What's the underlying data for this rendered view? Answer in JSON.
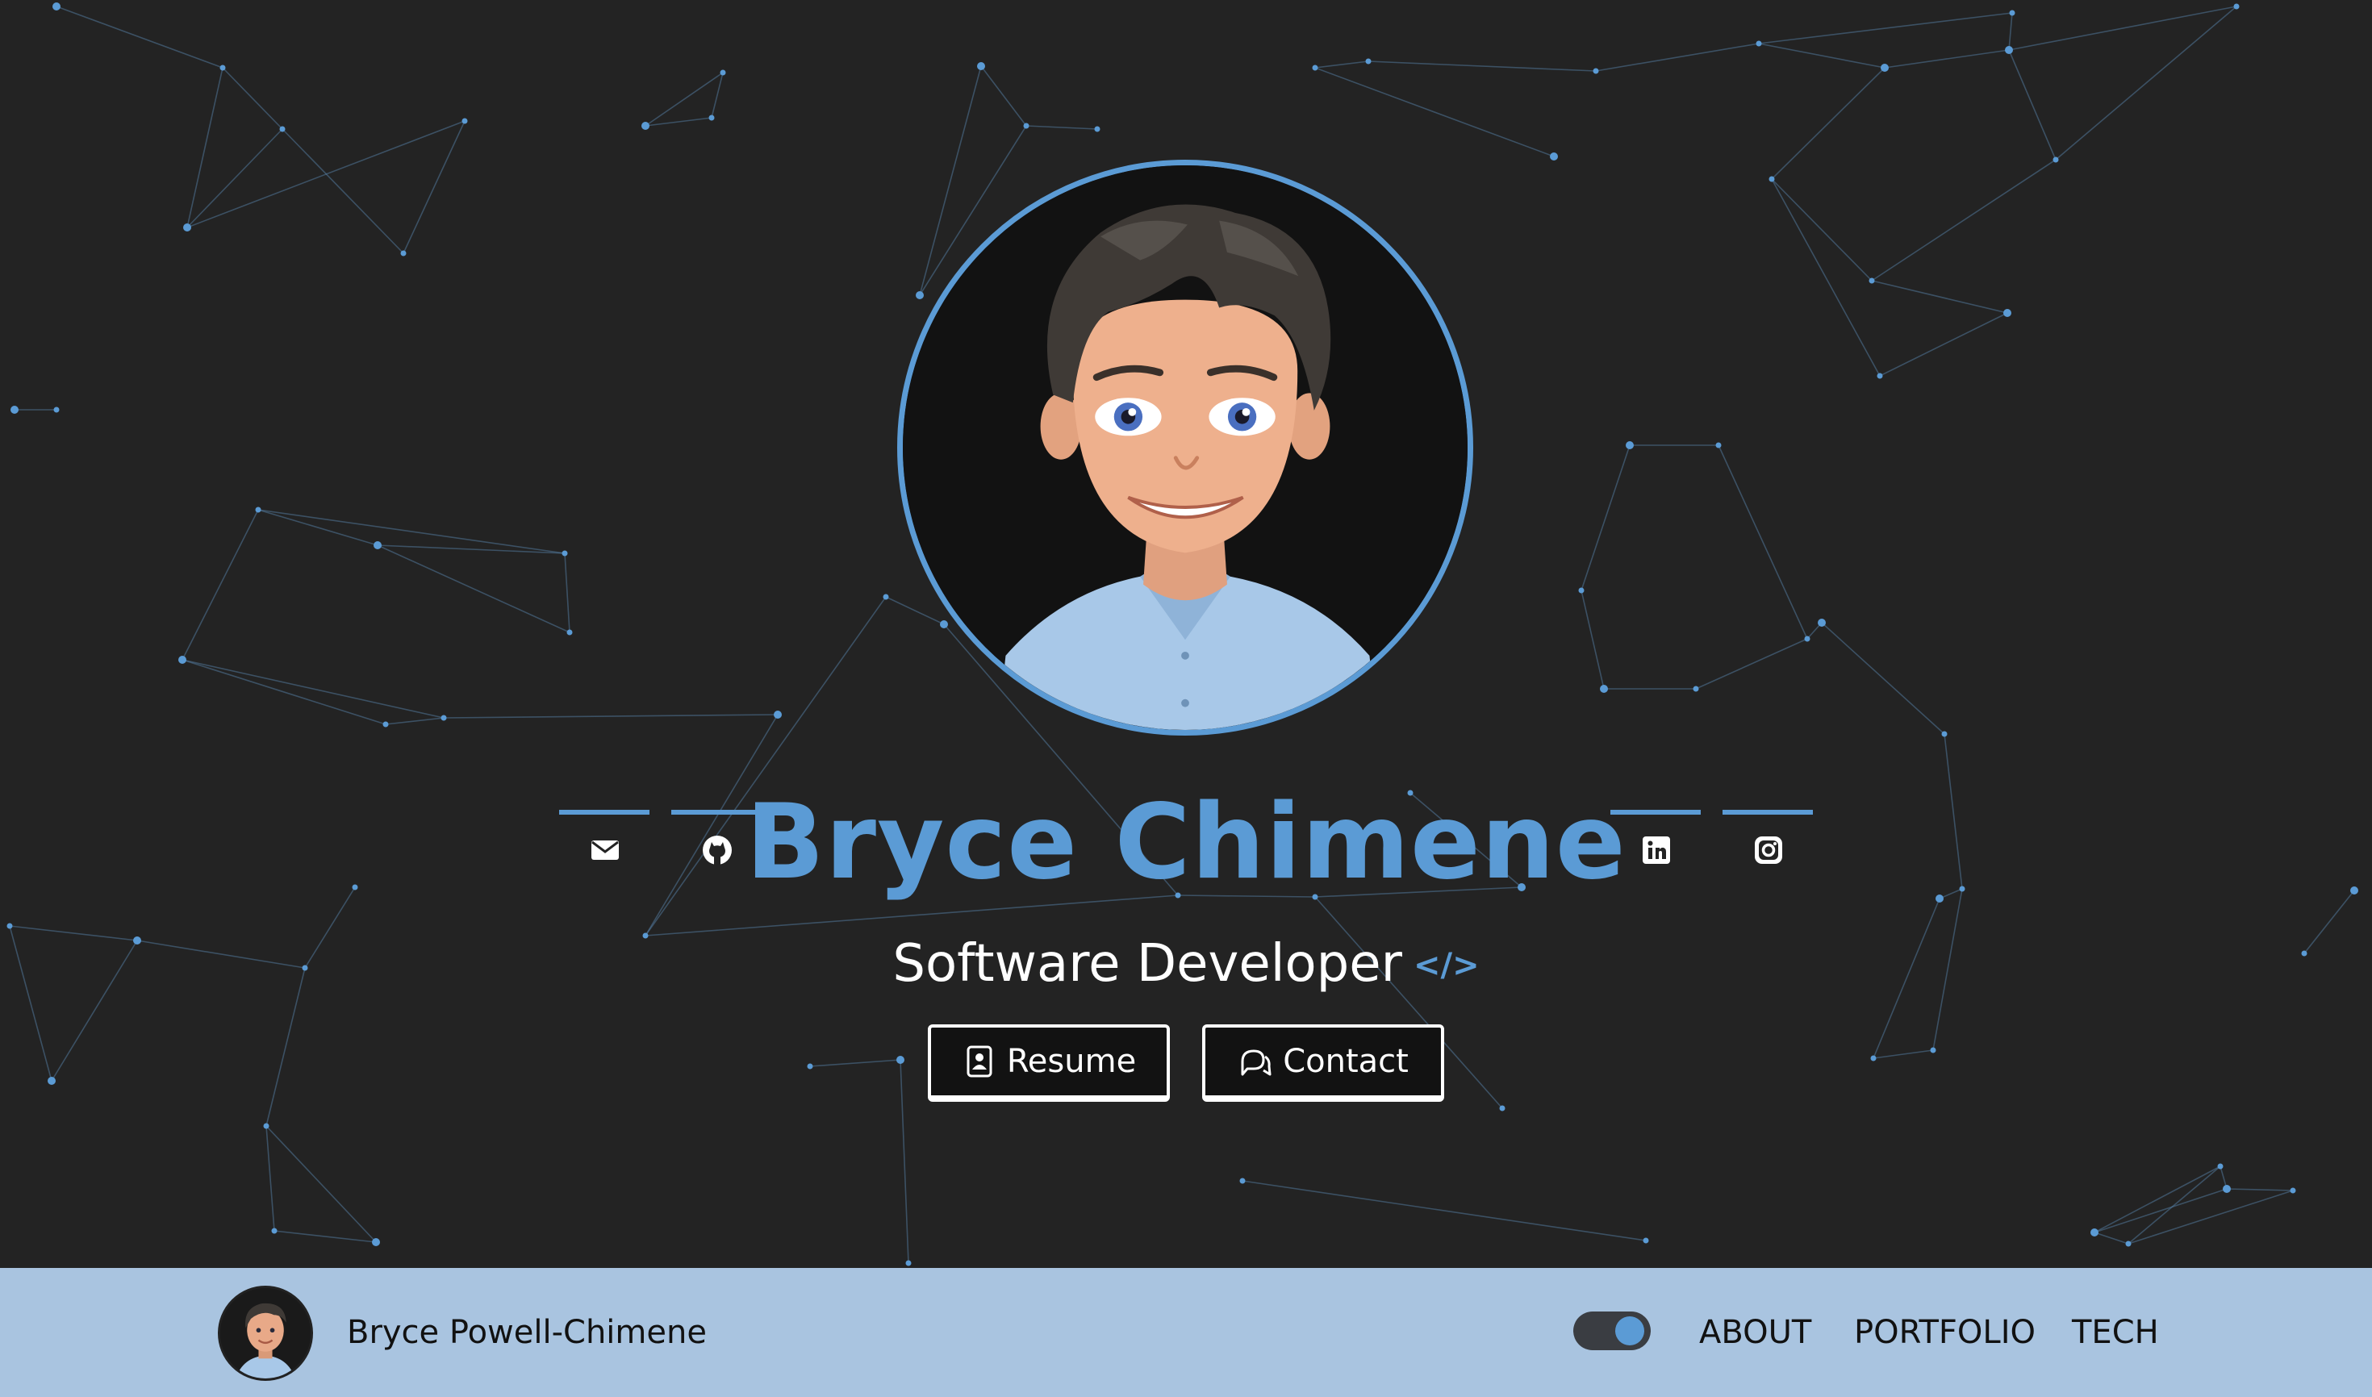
{
  "hero": {
    "name": "Bryce Chimene",
    "role": "Software Developer",
    "code_symbol": "</>",
    "buttons": [
      {
        "label": "Resume",
        "icon": "resume-icon"
      },
      {
        "label": "Contact",
        "icon": "chat-icon"
      }
    ],
    "social": [
      {
        "icon": "mail-icon"
      },
      {
        "icon": "github-icon"
      },
      {
        "icon": "linkedin-icon"
      },
      {
        "icon": "instagram-icon"
      }
    ]
  },
  "navbar": {
    "brand": "Bryce Powell-Chimene",
    "toggle_state": "on",
    "links": [
      "ABOUT",
      "PORTFOLIO",
      "TECH"
    ]
  },
  "colors": {
    "accent": "#5b9bd5",
    "background": "#232323",
    "navbar": "#a9c4e0",
    "text_light": "#ffffff",
    "text_dark": "#111111"
  }
}
